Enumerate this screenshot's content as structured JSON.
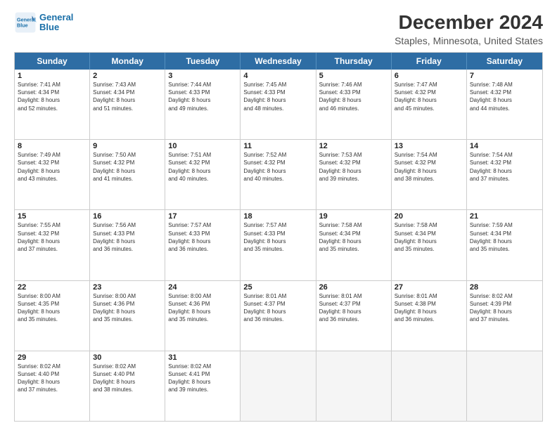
{
  "logo": {
    "line1": "General",
    "line2": "Blue"
  },
  "title": "December 2024",
  "subtitle": "Staples, Minnesota, United States",
  "days": [
    "Sunday",
    "Monday",
    "Tuesday",
    "Wednesday",
    "Thursday",
    "Friday",
    "Saturday"
  ],
  "weeks": [
    [
      {
        "date": "1",
        "sunrise": "7:41 AM",
        "sunset": "4:34 PM",
        "daylight": "8 hours and 52 minutes."
      },
      {
        "date": "2",
        "sunrise": "7:43 AM",
        "sunset": "4:34 PM",
        "daylight": "8 hours and 51 minutes."
      },
      {
        "date": "3",
        "sunrise": "7:44 AM",
        "sunset": "4:33 PM",
        "daylight": "8 hours and 49 minutes."
      },
      {
        "date": "4",
        "sunrise": "7:45 AM",
        "sunset": "4:33 PM",
        "daylight": "8 hours and 48 minutes."
      },
      {
        "date": "5",
        "sunrise": "7:46 AM",
        "sunset": "4:33 PM",
        "daylight": "8 hours and 46 minutes."
      },
      {
        "date": "6",
        "sunrise": "7:47 AM",
        "sunset": "4:32 PM",
        "daylight": "8 hours and 45 minutes."
      },
      {
        "date": "7",
        "sunrise": "7:48 AM",
        "sunset": "4:32 PM",
        "daylight": "8 hours and 44 minutes."
      }
    ],
    [
      {
        "date": "8",
        "sunrise": "7:49 AM",
        "sunset": "4:32 PM",
        "daylight": "8 hours and 43 minutes."
      },
      {
        "date": "9",
        "sunrise": "7:50 AM",
        "sunset": "4:32 PM",
        "daylight": "8 hours and 41 minutes."
      },
      {
        "date": "10",
        "sunrise": "7:51 AM",
        "sunset": "4:32 PM",
        "daylight": "8 hours and 40 minutes."
      },
      {
        "date": "11",
        "sunrise": "7:52 AM",
        "sunset": "4:32 PM",
        "daylight": "8 hours and 40 minutes."
      },
      {
        "date": "12",
        "sunrise": "7:53 AM",
        "sunset": "4:32 PM",
        "daylight": "8 hours and 39 minutes."
      },
      {
        "date": "13",
        "sunrise": "7:54 AM",
        "sunset": "4:32 PM",
        "daylight": "8 hours and 38 minutes."
      },
      {
        "date": "14",
        "sunrise": "7:54 AM",
        "sunset": "4:32 PM",
        "daylight": "8 hours and 37 minutes."
      }
    ],
    [
      {
        "date": "15",
        "sunrise": "7:55 AM",
        "sunset": "4:32 PM",
        "daylight": "8 hours and 37 minutes."
      },
      {
        "date": "16",
        "sunrise": "7:56 AM",
        "sunset": "4:33 PM",
        "daylight": "8 hours and 36 minutes."
      },
      {
        "date": "17",
        "sunrise": "7:57 AM",
        "sunset": "4:33 PM",
        "daylight": "8 hours and 36 minutes."
      },
      {
        "date": "18",
        "sunrise": "7:57 AM",
        "sunset": "4:33 PM",
        "daylight": "8 hours and 35 minutes."
      },
      {
        "date": "19",
        "sunrise": "7:58 AM",
        "sunset": "4:34 PM",
        "daylight": "8 hours and 35 minutes."
      },
      {
        "date": "20",
        "sunrise": "7:58 AM",
        "sunset": "4:34 PM",
        "daylight": "8 hours and 35 minutes."
      },
      {
        "date": "21",
        "sunrise": "7:59 AM",
        "sunset": "4:34 PM",
        "daylight": "8 hours and 35 minutes."
      }
    ],
    [
      {
        "date": "22",
        "sunrise": "8:00 AM",
        "sunset": "4:35 PM",
        "daylight": "8 hours and 35 minutes."
      },
      {
        "date": "23",
        "sunrise": "8:00 AM",
        "sunset": "4:36 PM",
        "daylight": "8 hours and 35 minutes."
      },
      {
        "date": "24",
        "sunrise": "8:00 AM",
        "sunset": "4:36 PM",
        "daylight": "8 hours and 35 minutes."
      },
      {
        "date": "25",
        "sunrise": "8:01 AM",
        "sunset": "4:37 PM",
        "daylight": "8 hours and 36 minutes."
      },
      {
        "date": "26",
        "sunrise": "8:01 AM",
        "sunset": "4:37 PM",
        "daylight": "8 hours and 36 minutes."
      },
      {
        "date": "27",
        "sunrise": "8:01 AM",
        "sunset": "4:38 PM",
        "daylight": "8 hours and 36 minutes."
      },
      {
        "date": "28",
        "sunrise": "8:02 AM",
        "sunset": "4:39 PM",
        "daylight": "8 hours and 37 minutes."
      }
    ],
    [
      {
        "date": "29",
        "sunrise": "8:02 AM",
        "sunset": "4:40 PM",
        "daylight": "8 hours and 37 minutes."
      },
      {
        "date": "30",
        "sunrise": "8:02 AM",
        "sunset": "4:40 PM",
        "daylight": "8 hours and 38 minutes."
      },
      {
        "date": "31",
        "sunrise": "8:02 AM",
        "sunset": "4:41 PM",
        "daylight": "8 hours and 39 minutes."
      },
      null,
      null,
      null,
      null
    ]
  ],
  "labels": {
    "sunrise": "Sunrise:",
    "sunset": "Sunset:",
    "daylight": "Daylight:"
  }
}
